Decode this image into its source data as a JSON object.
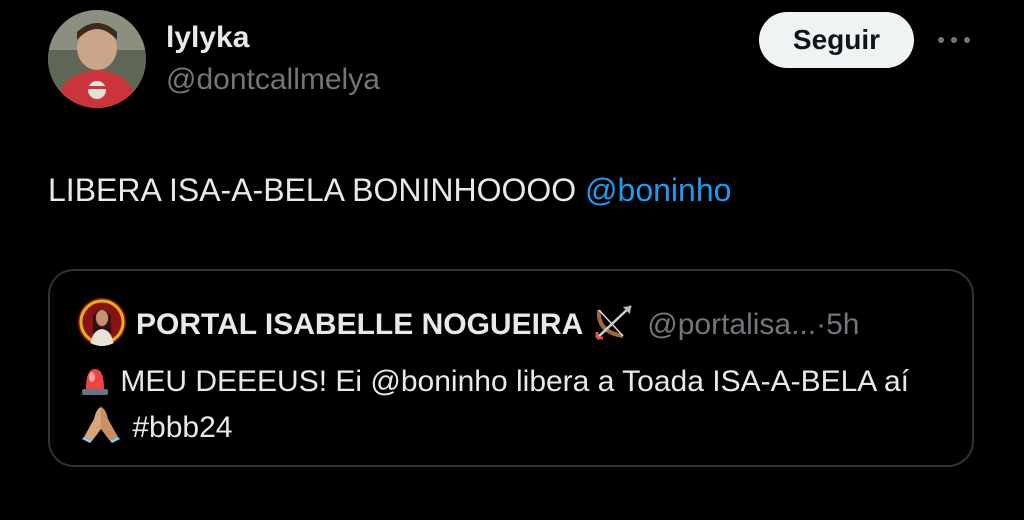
{
  "author": {
    "display_name": "lylyka",
    "handle": "@dontcallmelya",
    "avatar": "user-avatar-photo"
  },
  "actions": {
    "follow_label": "Seguir",
    "more_icon": "more-horizontal-icon"
  },
  "tweet": {
    "text": "LIBERA ISA-A-BELA BONINHOOOO",
    "mention": "@boninho"
  },
  "quote": {
    "display_name": "PORTAL ISABELLE NOGUEIRA",
    "name_emoji": "bow-and-arrow-emoji",
    "handle": "@portalisa...",
    "separator": "·",
    "time": "5h",
    "siren_emoji": "police-light-emoji",
    "text_1": "MEU DEEEUS! Ei",
    "mention": "@boninho",
    "text_2": "libera a Toada ISA-A-BELA aí",
    "pray_emoji": "folded-hands-emoji",
    "hashtag": "#bbb24"
  },
  "colors": {
    "background": "#000000",
    "text_primary": "#e7e9ea",
    "text_secondary": "#71767b",
    "link": "#1d9bf0",
    "border": "#2f3336",
    "follow_bg": "#eff3f4"
  }
}
